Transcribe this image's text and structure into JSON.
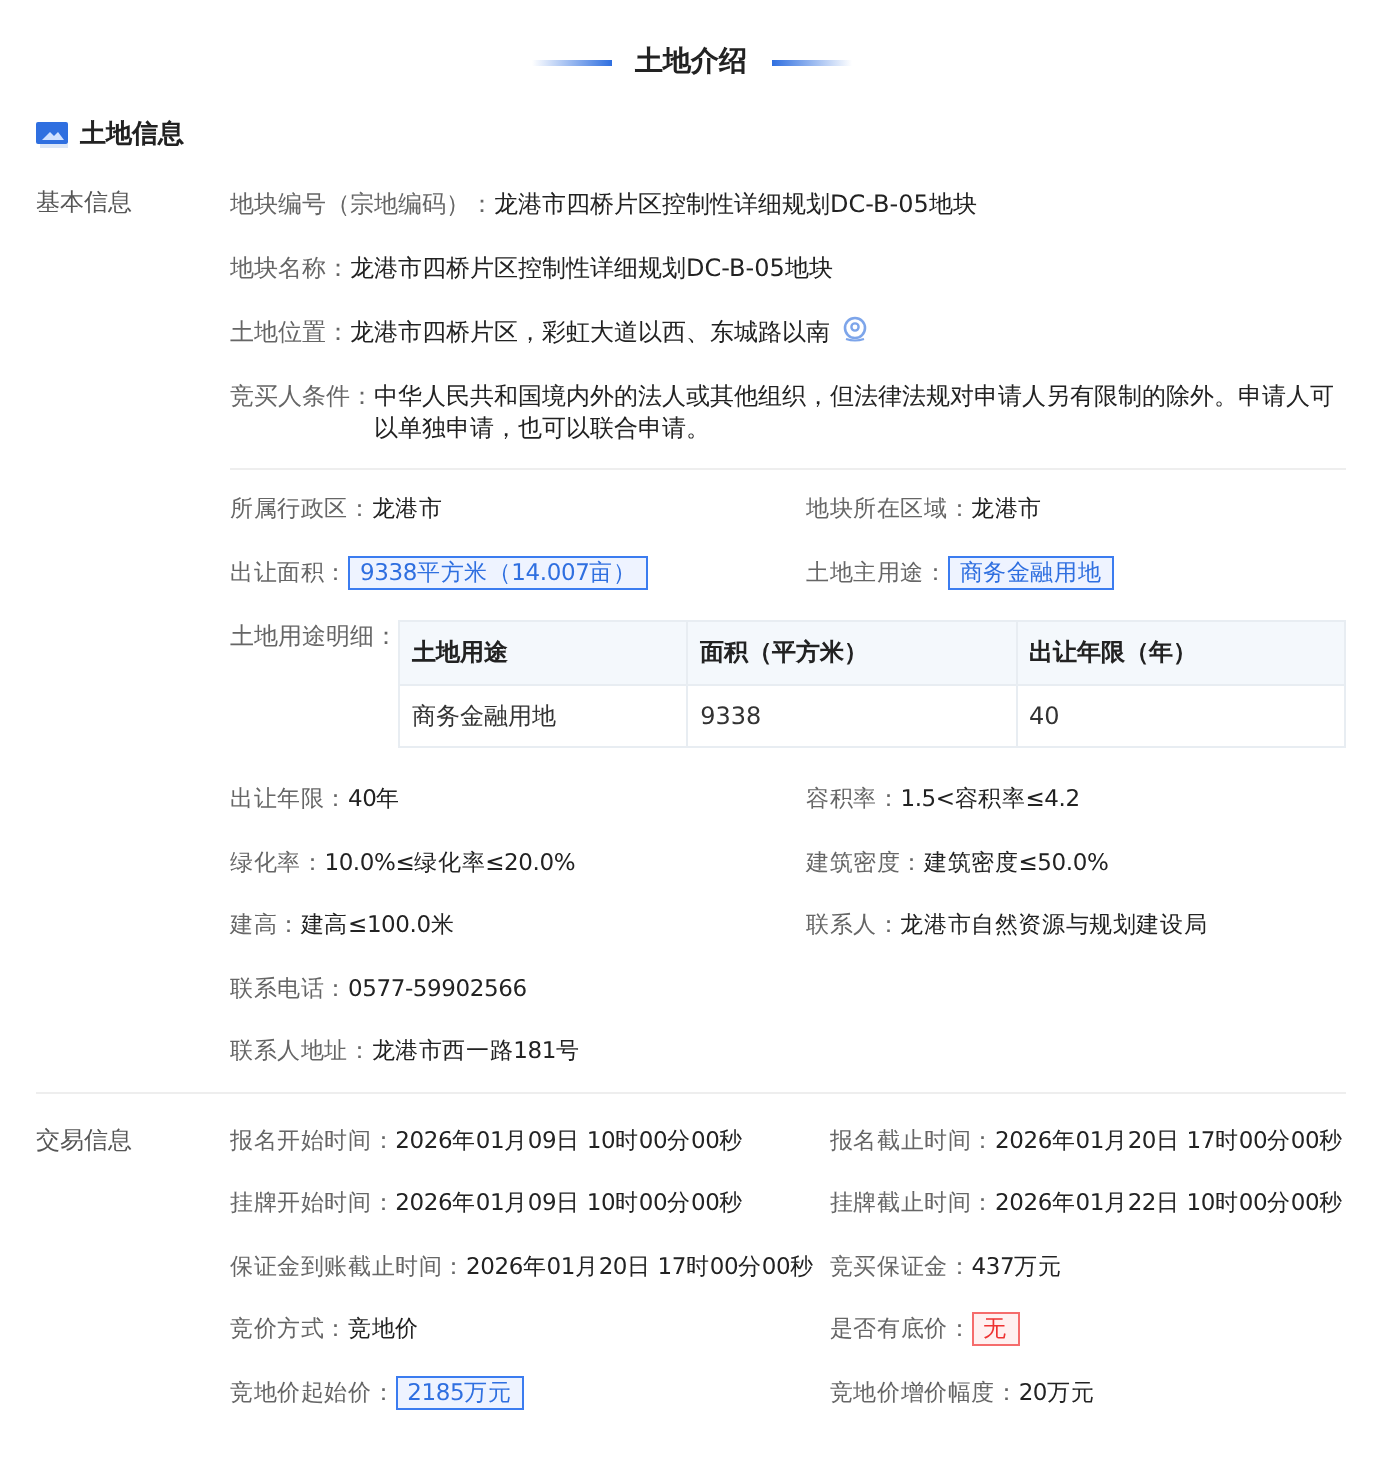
{
  "title": "土地介绍",
  "section": {
    "title": "土地信息"
  },
  "basic": {
    "label": "基本信息",
    "lines": [
      {
        "label": "地块编号（宗地编码）：",
        "value": "龙港市四桥片区控制性详细规划DC-B-05地块",
        "kind": "plain"
      },
      {
        "label": "地块名称：",
        "value": "龙港市四桥片区控制性详细规划DC-B-05地块",
        "kind": "plain"
      },
      {
        "label": "土地位置：",
        "value": "龙港市四桥片区，彩虹大道以西、东城路以南",
        "kind": "location"
      },
      {
        "label": "竞买人条件：",
        "value": "中华人民共和国境内外的法人或其他组织，但法律法规对申请人另有限制的除外。申请人可以单独申请，也可以联合申请。",
        "kind": "plain"
      }
    ],
    "grid": [
      {
        "label": "所属行政区：",
        "value": "龙港市",
        "kind": "plain"
      },
      {
        "label": "地块所在区域：",
        "value": "龙港市",
        "kind": "plain"
      },
      {
        "label": "出让面积：",
        "value": "9338平方米（14.007亩）",
        "kind": "tag"
      },
      {
        "label": "土地主用途：",
        "value": "商务金融用地",
        "kind": "tag"
      }
    ],
    "table": {
      "label": "土地用途明细：",
      "columns": [
        "土地用途",
        "面积（平方米）",
        "出让年限（年）"
      ],
      "rows": [
        [
          "商务金融用地",
          "9338",
          "40"
        ]
      ]
    },
    "grid2": [
      {
        "label": "出让年限：",
        "value": "40年",
        "kind": "plain"
      },
      {
        "label": "容积率：",
        "value": "1.5<容积率≤4.2",
        "kind": "plain"
      },
      {
        "label": "绿化率：",
        "value": "10.0%≤绿化率≤20.0%",
        "kind": "plain"
      },
      {
        "label": "建筑密度：",
        "value": "建筑密度≤50.0%",
        "kind": "plain"
      },
      {
        "label": "建高：",
        "value": "建高≤100.0米",
        "kind": "plain"
      },
      {
        "label": "联系人：",
        "value": "龙港市自然资源与规划建设局",
        "kind": "plain"
      },
      {
        "label": "联系电话：",
        "value": "0577-59902566",
        "kind": "plain"
      },
      {
        "label": "联系人地址：",
        "value": "龙港市西一路181号",
        "kind": "wide"
      }
    ]
  },
  "trade": {
    "label": "交易信息",
    "grid": [
      {
        "label": "报名开始时间：",
        "value": "2026年01月09日 10时00分00秒",
        "kind": "plain"
      },
      {
        "label": "报名截止时间：",
        "value": "2026年01月20日 17时00分00秒",
        "kind": "plain"
      },
      {
        "label": "挂牌开始时间：",
        "value": "2026年01月09日 10时00分00秒",
        "kind": "plain"
      },
      {
        "label": "挂牌截止时间：",
        "value": "2026年01月22日 10时00分00秒",
        "kind": "plain"
      },
      {
        "label": "保证金到账截止时间：",
        "value": "2026年01月20日 17时00分00秒",
        "kind": "plain"
      },
      {
        "label": "竞买保证金：",
        "value": "437万元",
        "kind": "plain"
      },
      {
        "label": "竞价方式：",
        "value": "竞地价",
        "kind": "plain"
      },
      {
        "label": "是否有底价：",
        "value": "无",
        "kind": "alert"
      },
      {
        "label": "竞地价起始价：",
        "value": "2185万元",
        "kind": "tag"
      },
      {
        "label": "竞地价增价幅度：",
        "value": "20万元",
        "kind": "plain"
      }
    ]
  }
}
